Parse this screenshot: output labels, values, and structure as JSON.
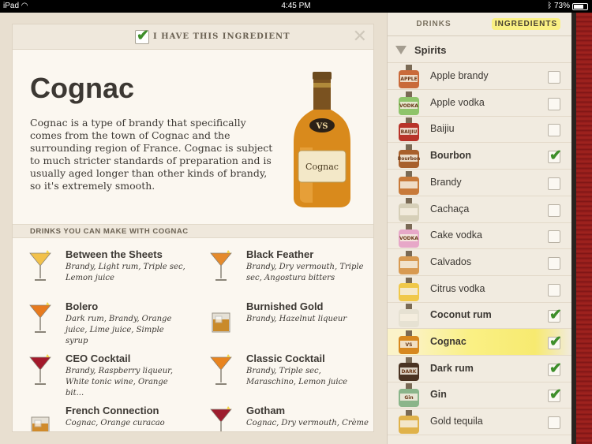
{
  "status_bar": {
    "device": "iPad",
    "wifi_icon": "wifi-icon",
    "time": "4:45 PM",
    "battery": "73%",
    "battery_level": 0.73
  },
  "detail": {
    "have_label": "I HAVE THIS INGREDIENT",
    "have_checked": true,
    "title": "Cognac",
    "description": "Cognac is a type of brandy that specifically comes from the town of Cognac and the surrounding region of France. Cognac is subject to much stricter standards of preparation and is usually aged longer than other kinds of brandy, so it's extremely smooth.",
    "bottle_label": "Cognac",
    "bottle_badge": "VS",
    "drinks_header": "DRINKS YOU CAN MAKE WITH COGNAC",
    "drinks": [
      {
        "name": "Between the Sheets",
        "ingredients": "Brandy, Light rum, Triple sec, Lemon juice",
        "glass": "cocktail-glass-icon",
        "color": "#f2c14a"
      },
      {
        "name": "Black Feather",
        "ingredients": "Brandy, Dry vermouth, Triple sec, Angostura bitters",
        "glass": "cocktail-glass-icon",
        "color": "#e58a2b"
      },
      {
        "name": "Bolero",
        "ingredients": "Dark rum, Brandy, Orange juice, Lime juice, Simple syrup",
        "glass": "cocktail-glass-icon",
        "color": "#e77a1e"
      },
      {
        "name": "Burnished Gold",
        "ingredients": "Brandy, Hazelnut liqueur",
        "glass": "rocks-glass-icon",
        "color": "#c98a2a"
      },
      {
        "name": "CEO Cocktail",
        "ingredients": "Brandy, Raspberry liqueur, White tonic wine, Orange bit...",
        "glass": "cocktail-glass-icon",
        "color": "#a3192b"
      },
      {
        "name": "Classic Cocktail",
        "ingredients": "Brandy, Triple sec, Maraschino, Lemon juice",
        "glass": "cocktail-glass-icon",
        "color": "#e8841f"
      },
      {
        "name": "French Connection",
        "ingredients": "Cognac, Orange curacao",
        "glass": "rocks-glass-icon",
        "color": "#d08b2c"
      },
      {
        "name": "Gotham",
        "ingredients": "Cognac, Dry vermouth, Crème",
        "glass": "cocktail-glass-icon",
        "color": "#9d1d2e"
      }
    ]
  },
  "tabs": {
    "drinks": "DRINKS",
    "ingredients": "INGREDIENTS",
    "active": "ingredients"
  },
  "category": {
    "label": "Spirits"
  },
  "ingredients": [
    {
      "name": "Apple brandy",
      "checked": false,
      "color": "#c96a3a",
      "label": "APPLE"
    },
    {
      "name": "Apple vodka",
      "checked": false,
      "color": "#8fc46a",
      "label": "VODKA"
    },
    {
      "name": "Baijiu",
      "checked": false,
      "color": "#b8342a",
      "label": "BAIJIU"
    },
    {
      "name": "Bourbon",
      "checked": true,
      "color": "#a8602c",
      "label": "Bourbon"
    },
    {
      "name": "Brandy",
      "checked": false,
      "color": "#c87a3a",
      "label": ""
    },
    {
      "name": "Cachaça",
      "checked": false,
      "color": "#d6cfb8",
      "label": ""
    },
    {
      "name": "Cake vodka",
      "checked": false,
      "color": "#e7a8c8",
      "label": "VODKA"
    },
    {
      "name": "Calvados",
      "checked": false,
      "color": "#d89a52",
      "label": ""
    },
    {
      "name": "Citrus vodka",
      "checked": false,
      "color": "#f0c84a",
      "label": ""
    },
    {
      "name": "Coconut rum",
      "checked": true,
      "color": "#e6e1d2",
      "label": ""
    },
    {
      "name": "Cognac",
      "checked": true,
      "color": "#d7881f",
      "label": "VS",
      "highlighted": true
    },
    {
      "name": "Dark rum",
      "checked": true,
      "color": "#4a3322",
      "label": "DARK"
    },
    {
      "name": "Gin",
      "checked": true,
      "color": "#8ab58a",
      "label": "Gin"
    },
    {
      "name": "Gold tequila",
      "checked": false,
      "color": "#e0b24a",
      "label": ""
    }
  ]
}
